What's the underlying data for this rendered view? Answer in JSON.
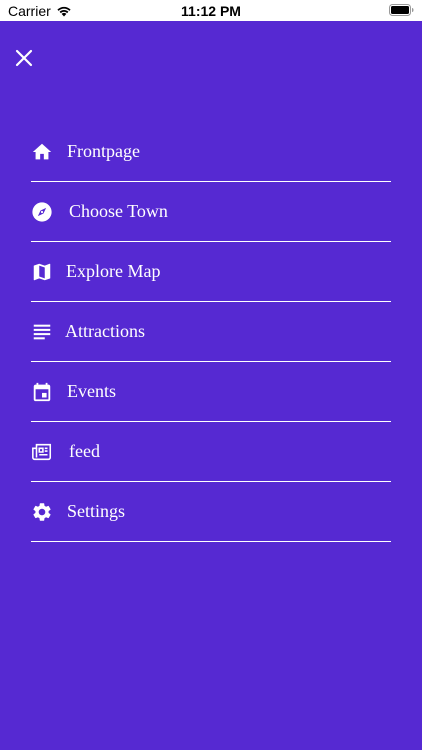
{
  "status_bar": {
    "carrier": "Carrier",
    "time": "11:12 PM",
    "wifi_icon": "wifi-icon",
    "battery_icon": "battery-icon"
  },
  "close_icon": "close-icon",
  "colors": {
    "background": "#5629D2",
    "text": "#FFFFFF",
    "divider": "#FFFFFF"
  },
  "menu": {
    "items": [
      {
        "label": "Frontpage",
        "icon": "home-icon"
      },
      {
        "label": "Choose Town",
        "icon": "compass-icon"
      },
      {
        "label": "Explore Map",
        "icon": "map-icon"
      },
      {
        "label": "Attractions",
        "icon": "list-icon"
      },
      {
        "label": "Events",
        "icon": "calendar-icon"
      },
      {
        "label": "feed",
        "icon": "newspaper-icon"
      },
      {
        "label": "Settings",
        "icon": "gear-icon"
      }
    ]
  }
}
